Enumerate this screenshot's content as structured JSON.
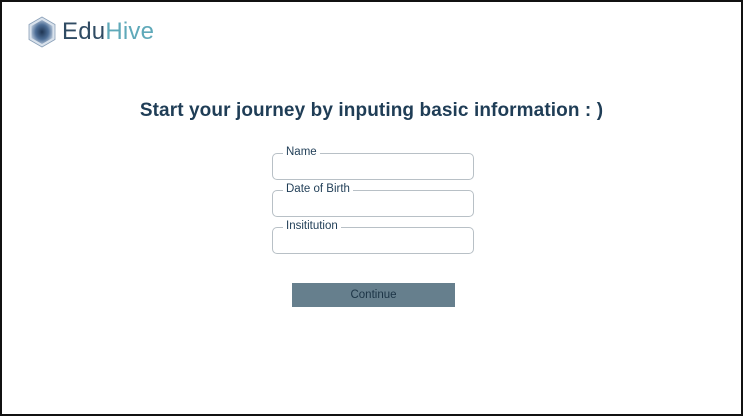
{
  "brand": {
    "name_part1": "Edu",
    "name_part2": "Hive",
    "icon": "hexagon-cube-logo-icon",
    "colors": {
      "primary": "#2f4b63",
      "accent": "#5fa9b9"
    }
  },
  "main": {
    "heading": "Start your journey by inputing basic information : )"
  },
  "form": {
    "fields": [
      {
        "label": "Name",
        "value": "",
        "placeholder": ""
      },
      {
        "label": "Date of Birth",
        "value": "",
        "placeholder": ""
      },
      {
        "label": "Insititution",
        "value": "",
        "placeholder": ""
      }
    ],
    "continue_label": "Continue",
    "button_color": "#667f8d"
  }
}
